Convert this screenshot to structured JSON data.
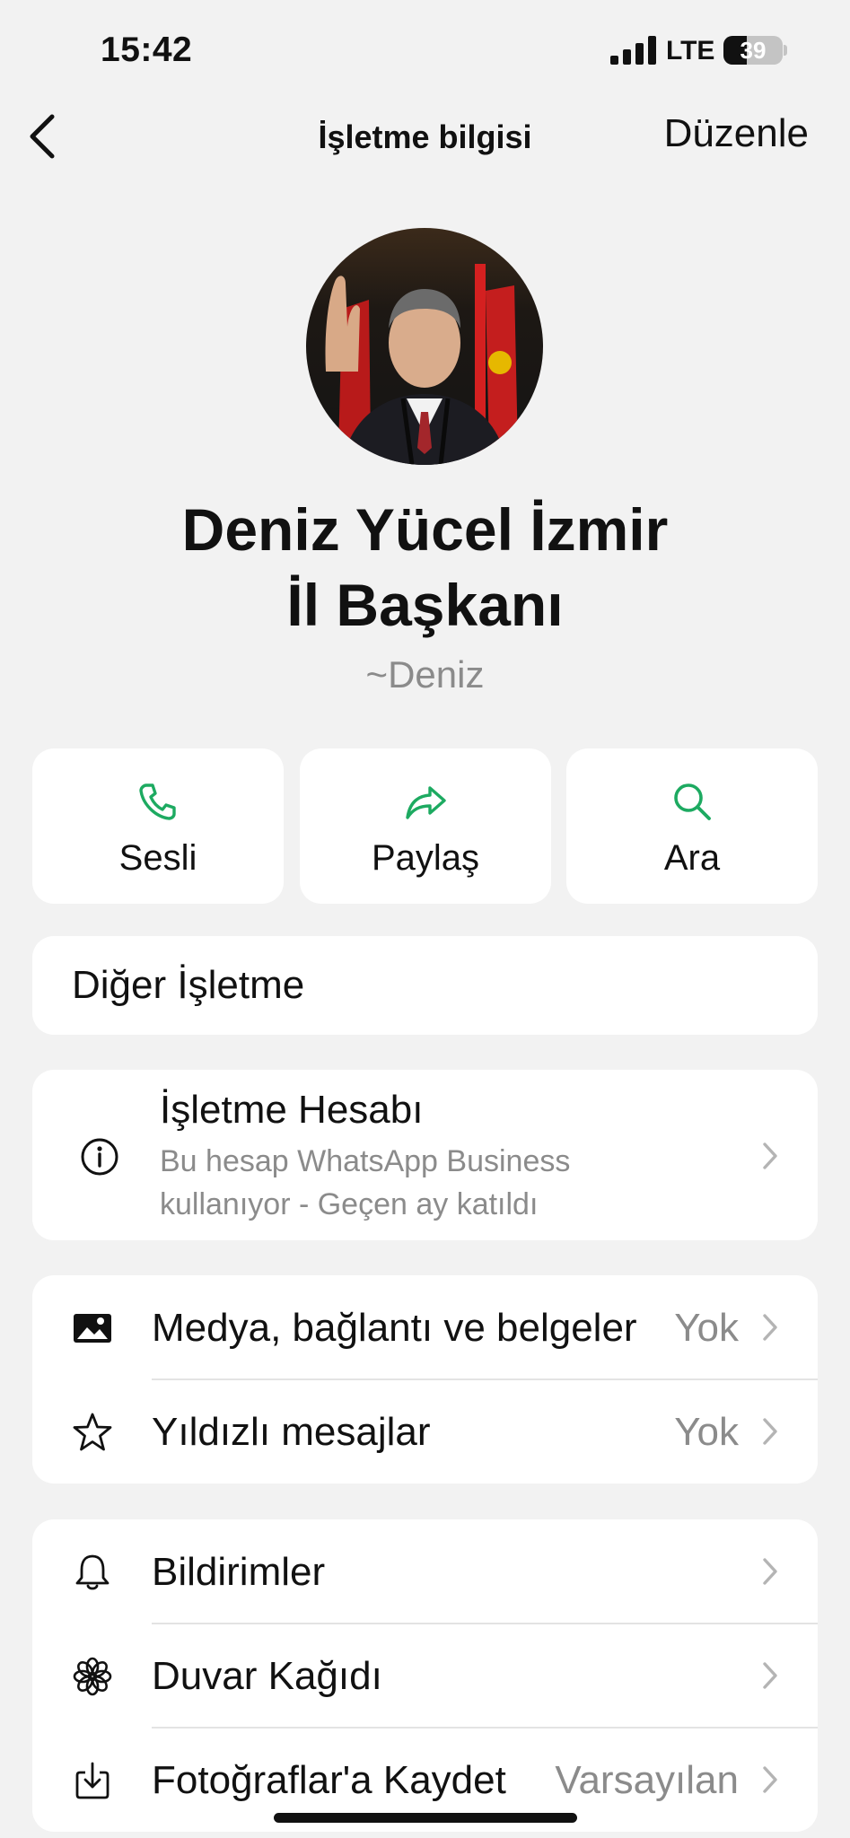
{
  "status_bar": {
    "time": "15:42",
    "network": "LTE",
    "battery": "39",
    "battery_level": 0.39
  },
  "nav": {
    "title": "İşletme bilgisi",
    "edit_label": "Düzenle",
    "back_icon": "chevron-left-icon"
  },
  "profile": {
    "name_line1": "Deniz Yücel İzmir",
    "name_line2": "İl Başkanı",
    "handle": "~Deniz"
  },
  "actions": [
    {
      "label": "Sesli",
      "icon": "phone-icon"
    },
    {
      "label": "Paylaş",
      "icon": "share-arrow-icon"
    },
    {
      "label": "Ara",
      "icon": "search-icon"
    }
  ],
  "other_business": {
    "label": "Diğer İşletme"
  },
  "business_account": {
    "title": "İşletme Hesabı",
    "subtitle": "Bu hesap WhatsApp Business kullanıyor - Geçen ay katıldı",
    "icon": "info-icon"
  },
  "media_section": [
    {
      "label": "Medya, bağlantı ve belgeler",
      "value": "Yok",
      "icon": "image-icon"
    },
    {
      "label": "Yıldızlı mesajlar",
      "value": "Yok",
      "icon": "star-icon"
    }
  ],
  "settings_section": [
    {
      "label": "Bildirimler",
      "value": "",
      "icon": "bell-icon"
    },
    {
      "label": "Duvar Kağıdı",
      "value": "",
      "icon": "flower-icon"
    },
    {
      "label": "Fotoğraflar'a Kaydet",
      "value": "Varsayılan",
      "icon": "download-icon"
    }
  ],
  "colors": {
    "accent": "#1DAA61",
    "background": "#F2F2F2",
    "card": "#FFFFFF",
    "secondary_text": "#8B8B8B"
  }
}
